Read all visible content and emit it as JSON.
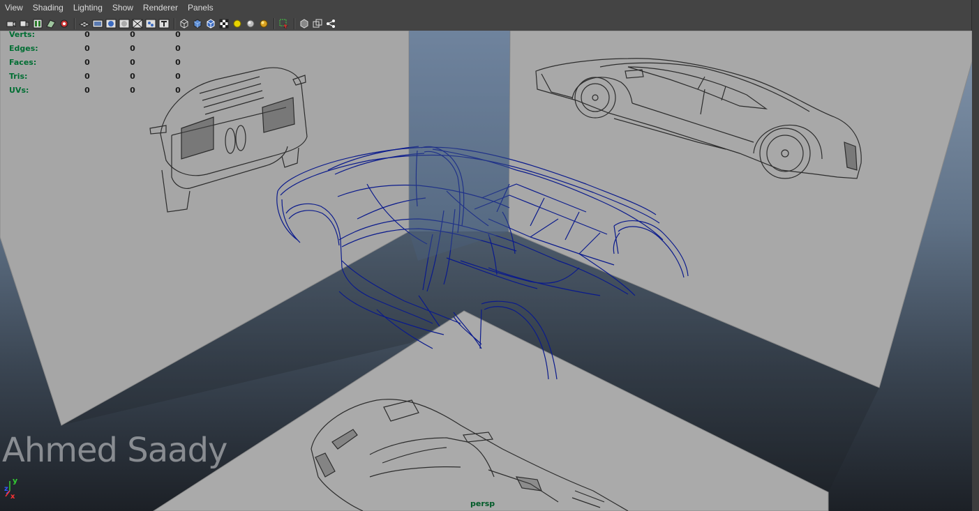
{
  "menu": [
    "View",
    "Shading",
    "Lighting",
    "Show",
    "Renderer",
    "Panels"
  ],
  "toolbar": {
    "group1": [
      "select-camera-icon",
      "camera-attributes-icon",
      "bookmark-icon",
      "image-plane-icon",
      "two-d-pan-zoom-icon"
    ],
    "group2": [
      "grid-icon",
      "film-gate-icon",
      "resolution-gate-icon",
      "gate-mask-icon",
      "field-chart-icon",
      "safe-action-icon",
      "safe-title-icon"
    ],
    "group3": [
      "wireframe-icon",
      "smooth-shade-icon",
      "shaded-wireframe-icon",
      "textured-icon",
      "use-all-lights-icon",
      "shadows-icon",
      "high-quality-icon"
    ],
    "group4": [
      "isolate-select-icon"
    ],
    "group5": [
      "xray-icon",
      "xray-joints-icon",
      "xray-components-icon"
    ]
  },
  "hud": {
    "rows": [
      {
        "label": "Verts:",
        "v1": "0",
        "v2": "0",
        "v3": "0"
      },
      {
        "label": "Edges:",
        "v1": "0",
        "v2": "0",
        "v3": "0"
      },
      {
        "label": "Faces:",
        "v1": "0",
        "v2": "0",
        "v3": "0"
      },
      {
        "label": "Tris:",
        "v1": "0",
        "v2": "0",
        "v3": "0"
      },
      {
        "label": "UVs:",
        "v1": "0",
        "v2": "0",
        "v3": "0"
      }
    ]
  },
  "watermark": "Ahmed Saady",
  "camera": "persp",
  "axis": {
    "y": "y",
    "z": "z",
    "x": "x"
  },
  "colors": {
    "curve": "#0a1a8c",
    "sketch": "#2a2a2a",
    "plane": "#a6a6a6",
    "hud_label": "#006e33"
  }
}
